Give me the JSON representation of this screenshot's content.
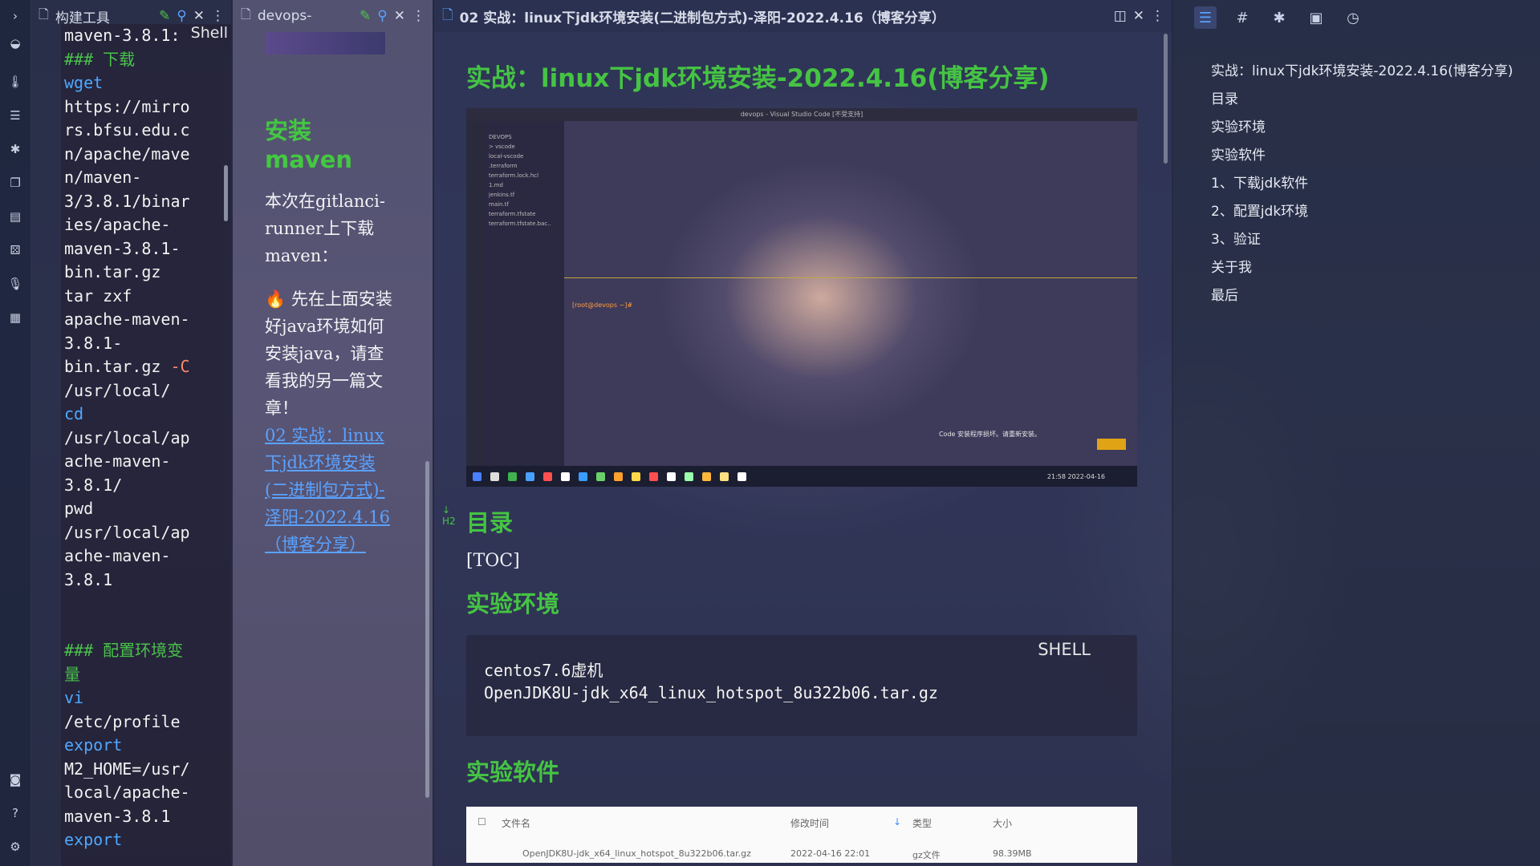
{
  "tabs": [
    {
      "label": "构建工具"
    },
    {
      "label": "devops-"
    },
    {
      "label": "02 实战：linux下jdk环境安装(二进制包方式)-泽阳-2022.4.16（博客分享）"
    }
  ],
  "pane1": {
    "lang_label": "Shell",
    "lines": [
      {
        "t": "maven-3.8.1:",
        "c": ""
      },
      {
        "t": "### 下载",
        "c": "hd"
      },
      {
        "t": "wget",
        "c": "kw"
      },
      {
        "t": "https://mirro",
        "c": ""
      },
      {
        "t": "rs.bfsu.edu.c",
        "c": ""
      },
      {
        "t": "n/apache/mave",
        "c": ""
      },
      {
        "t": "n/maven-",
        "c": ""
      },
      {
        "t": "3/3.8.1/binar",
        "c": ""
      },
      {
        "t": "ies/apache-",
        "c": ""
      },
      {
        "t": "maven-3.8.1-",
        "c": ""
      },
      {
        "t": "bin.tar.gz",
        "c": ""
      },
      {
        "t": "tar zxf",
        "c": ""
      },
      {
        "t": "apache-maven-",
        "c": ""
      },
      {
        "t": "3.8.1-",
        "c": ""
      },
      {
        "t": "bin.tar.gz -C",
        "c": "flag"
      },
      {
        "t": "/usr/local/",
        "c": ""
      },
      {
        "t": "cd",
        "c": "kw"
      },
      {
        "t": "/usr/local/ap",
        "c": ""
      },
      {
        "t": "ache-maven-",
        "c": ""
      },
      {
        "t": "3.8.1/",
        "c": ""
      },
      {
        "t": "pwd",
        "c": ""
      },
      {
        "t": "/usr/local/ap",
        "c": ""
      },
      {
        "t": "ache-maven-",
        "c": ""
      },
      {
        "t": "3.8.1",
        "c": ""
      },
      {
        "t": "",
        "c": ""
      },
      {
        "t": "",
        "c": ""
      },
      {
        "t": "### 配置环境变",
        "c": "hd"
      },
      {
        "t": "量",
        "c": "hd"
      },
      {
        "t": "vi",
        "c": "kw"
      },
      {
        "t": "/etc/profile",
        "c": ""
      },
      {
        "t": "export",
        "c": "kw"
      },
      {
        "t": "M2_HOME=/usr/",
        "c": ""
      },
      {
        "t": "local/apache-",
        "c": ""
      },
      {
        "t": "maven-3.8.1",
        "c": ""
      },
      {
        "t": "export",
        "c": "kw"
      }
    ]
  },
  "pane2": {
    "title": "安装maven",
    "para1": "本次在gitlanci-runner上下载maven：",
    "para2": "先在上面安装好java环境如何安装java，请查看我的另一篇文章！",
    "link": "02 实战：linux下jdk环境安装(二进制包方式)-泽阳-2022.4.16（博客分享）"
  },
  "doc": {
    "title": "实战：linux下jdk环境安装-2022.4.16(博客分享)",
    "embedded_window_title": "devops - Visual Studio Code [不受支持]",
    "embedded_tree": [
      "DEVOPS",
      "> vscode",
      "local-vscode",
      ".terraform",
      "terraform.lock.hcl",
      "1.md",
      "jenkins.tf",
      "main.tf",
      "terraform.tfstate",
      "terraform.tfstate.bac.."
    ],
    "embedded_prompt": "[root@devops ~]#",
    "embedded_notice": "Code 安装程序损坏。请重新安装。",
    "embedded_clock": "21:58 2022-04-16",
    "h_toc": "目录",
    "h2_marker": "H2",
    "toc_text": "[TOC]",
    "h_env": "实验环境",
    "code_lang": "SHELL",
    "code_lines": [
      "centos7.6虚机",
      "OpenJDK8U-jdk_x64_linux_hotspot_8u322b06.tar.gz"
    ],
    "h_soft": "实验软件",
    "table_headers": [
      "文件名",
      "修改时间",
      "类型",
      "大小"
    ],
    "table_row": [
      "OpenJDK8U-jdk_x64_linux_hotspot_8u322b06.tar.gz",
      "2022-04-16 22:01",
      "gz文件",
      "98.39MB"
    ]
  },
  "outline": {
    "items": [
      "实战：linux下jdk环境安装-2022.4.16(博客分享)",
      "目录",
      "实验环境",
      "实验软件",
      "1、下载jdk软件",
      "2、配置jdk环境",
      "3、验证",
      "关于我",
      "最后"
    ]
  },
  "colors": {
    "heading": "#45c443",
    "link": "#5aa2ff",
    "keyword": "#4fa8ff"
  }
}
